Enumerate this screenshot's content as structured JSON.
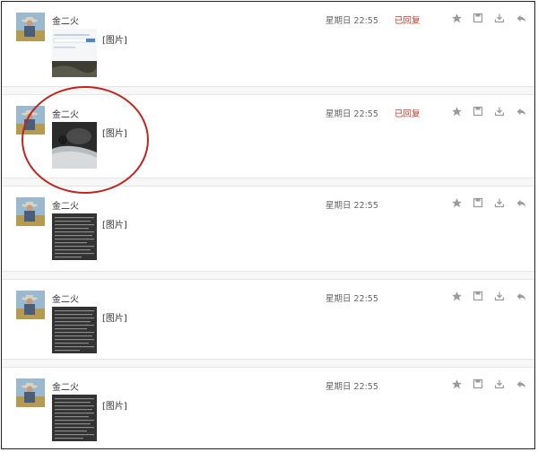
{
  "messages": [
    {
      "sender": "金二火",
      "preview": "[图片]",
      "time": "星期日 22:55",
      "status": "已回复"
    },
    {
      "sender": "金二火",
      "preview": "[图片]",
      "time": "星期日 22:55",
      "status": "已回复"
    },
    {
      "sender": "金二火",
      "preview": "[图片]",
      "time": "星期日 22:55",
      "status": ""
    },
    {
      "sender": "金二火",
      "preview": "[图片]",
      "time": "星期日 22:55",
      "status": ""
    },
    {
      "sender": "金二火",
      "preview": "[图片]",
      "time": "星期日 22:55",
      "status": ""
    }
  ],
  "icons": [
    "star-icon",
    "save-icon",
    "download-icon",
    "reply-icon"
  ],
  "colors": {
    "status_replied": "#c0392b",
    "annotation_circle": "#c0251f",
    "icon": "#9a9a9a"
  }
}
